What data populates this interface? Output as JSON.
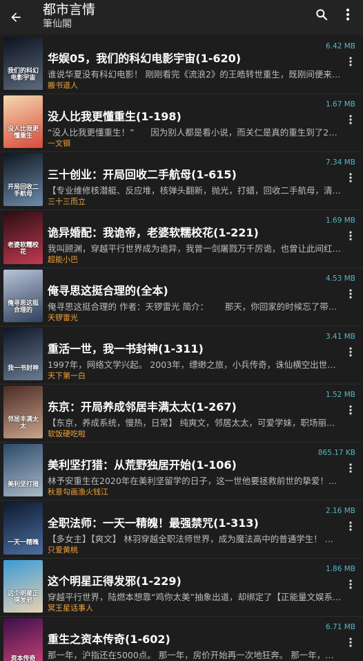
{
  "toolbar": {
    "title": "都市言情",
    "subtitle": "筆仙閣"
  },
  "colors": {
    "background": "#1d1d1d",
    "toolbar": "#232323",
    "size_text": "#55b7c8",
    "author_text": "#f0a23b"
  },
  "books": [
    {
      "title": "华娱05，我们的科幻电影宇宙(1-620)",
      "intro": "谁说华夏没有科幻电影！ 刚刚看完《流浪2》的王皓转世重生，既刚间便来…",
      "author": "搬书道人",
      "size": "6.42 MB",
      "cover_text": "我们的科幻电影宇宙",
      "cover_colors": [
        "#0c1220",
        "#5b6a7a"
      ]
    },
    {
      "title": "没人比我更懂重生(1-198)",
      "intro": "“没人比我更懂重生！”      因为别人都是看小说，而关仁是真的重生到了20…",
      "author": "一文钢",
      "size": "1.67 MB",
      "cover_text": "没人比我更懂重生",
      "cover_colors": [
        "#f3d9b0",
        "#d94a3a"
      ]
    },
    {
      "title": "三十创业：开局回收二手航母(1-615)",
      "intro": "【专业维修核潜艇、反应堆，核弹头翻新，抛光，打蜡，回收二手航母，清…",
      "author": "三十三而立",
      "size": "7.34 MB",
      "cover_text": "开局回收二手航母",
      "cover_colors": [
        "#0f1722",
        "#6d8cab"
      ]
    },
    {
      "title": "诡异婚配：我诡帝，老婆软糯校花(1-221)",
      "intro": "我叫顾渊，穿越平行世界成为诡异，我曾一剑屠戮万千厉诡，也曾让此间红…",
      "author": "超能小巴",
      "size": "1.69 MB",
      "cover_text": "老婆软糯校花",
      "cover_colors": [
        "#2a0d12",
        "#c23a52"
      ]
    },
    {
      "title": "俺寻思这挺合理的(全本)",
      "intro": "俺寻思这挺合理的 作者：天锣雷光 简介：      那天，你回家的时候忘了带钥…",
      "author": "天锣雷光",
      "size": "4.53 MB",
      "cover_text": "俺寻思这挺合理的",
      "cover_colors": [
        "#b9c4d8",
        "#30405c"
      ]
    },
    {
      "title": "重活一世，我一书封神(1-311)",
      "intro": "1997年，网络文学兴起。 2003年，缥缈之旅，小兵传奇，诛仙横空出世。…",
      "author": "天下第一白",
      "size": "3.41 MB",
      "cover_text": "我一书封神",
      "cover_colors": [
        "#0e1626",
        "#6a7b92"
      ]
    },
    {
      "title": "东京：开局养成邻居丰满太太(1-267)",
      "intro": "【东京，养成系统，慢热，日常】 纯爽文，邻居太太，可爱学妹，职场丽人…",
      "author": "软饭硬吃啦",
      "size": "1.52 MB",
      "cover_text": "邻居丰满太太",
      "cover_colors": [
        "#4a2a24",
        "#c9a58c"
      ]
    },
    {
      "title": "美利坚打猎：从荒野独居开始(1-106)",
      "intro": "林予安重生在2020年在美利坚留学的日子，这一世他要拯救前世的挚爱！…",
      "author": "秋意勾画渔火钱江",
      "size": "865.17 KB",
      "cover_text": "美利坚打猎",
      "cover_colors": [
        "#2d4a6b",
        "#a9b9c7"
      ]
    },
    {
      "title": "全职法师：一天一精魄！最强禁咒(1-313)",
      "intro": "【多女主】【爽文】 林羽穿越全职法师世界，成为魔法高中的普通学生！ 博…",
      "author": "只爱黄桃",
      "size": "2.16 MB",
      "cover_text": "一天一精魄",
      "cover_colors": [
        "#0d1a2e",
        "#4c6ea1"
      ]
    },
    {
      "title": "这个明星正得发邪(1-229)",
      "intro": "穿越平行世界，陆燃本想靠“鸡你太美”抽象出道，却绑定了【正能量文娱系…",
      "author": "冥王星话事人",
      "size": "1.86 MB",
      "cover_text": "这个明星正得发邪",
      "cover_colors": [
        "#3a9ad6",
        "#e8d2b2"
      ]
    },
    {
      "title": "重生之资本传奇(1-602)",
      "intro": "那一年，沪指还在5000点。 那一年，房价开始再一次地狂奔。 那一年，移…",
      "author": "",
      "size": "6.71 MB",
      "cover_text": "资本传奇",
      "cover_colors": [
        "#3a0f4a",
        "#d4487a"
      ]
    }
  ]
}
